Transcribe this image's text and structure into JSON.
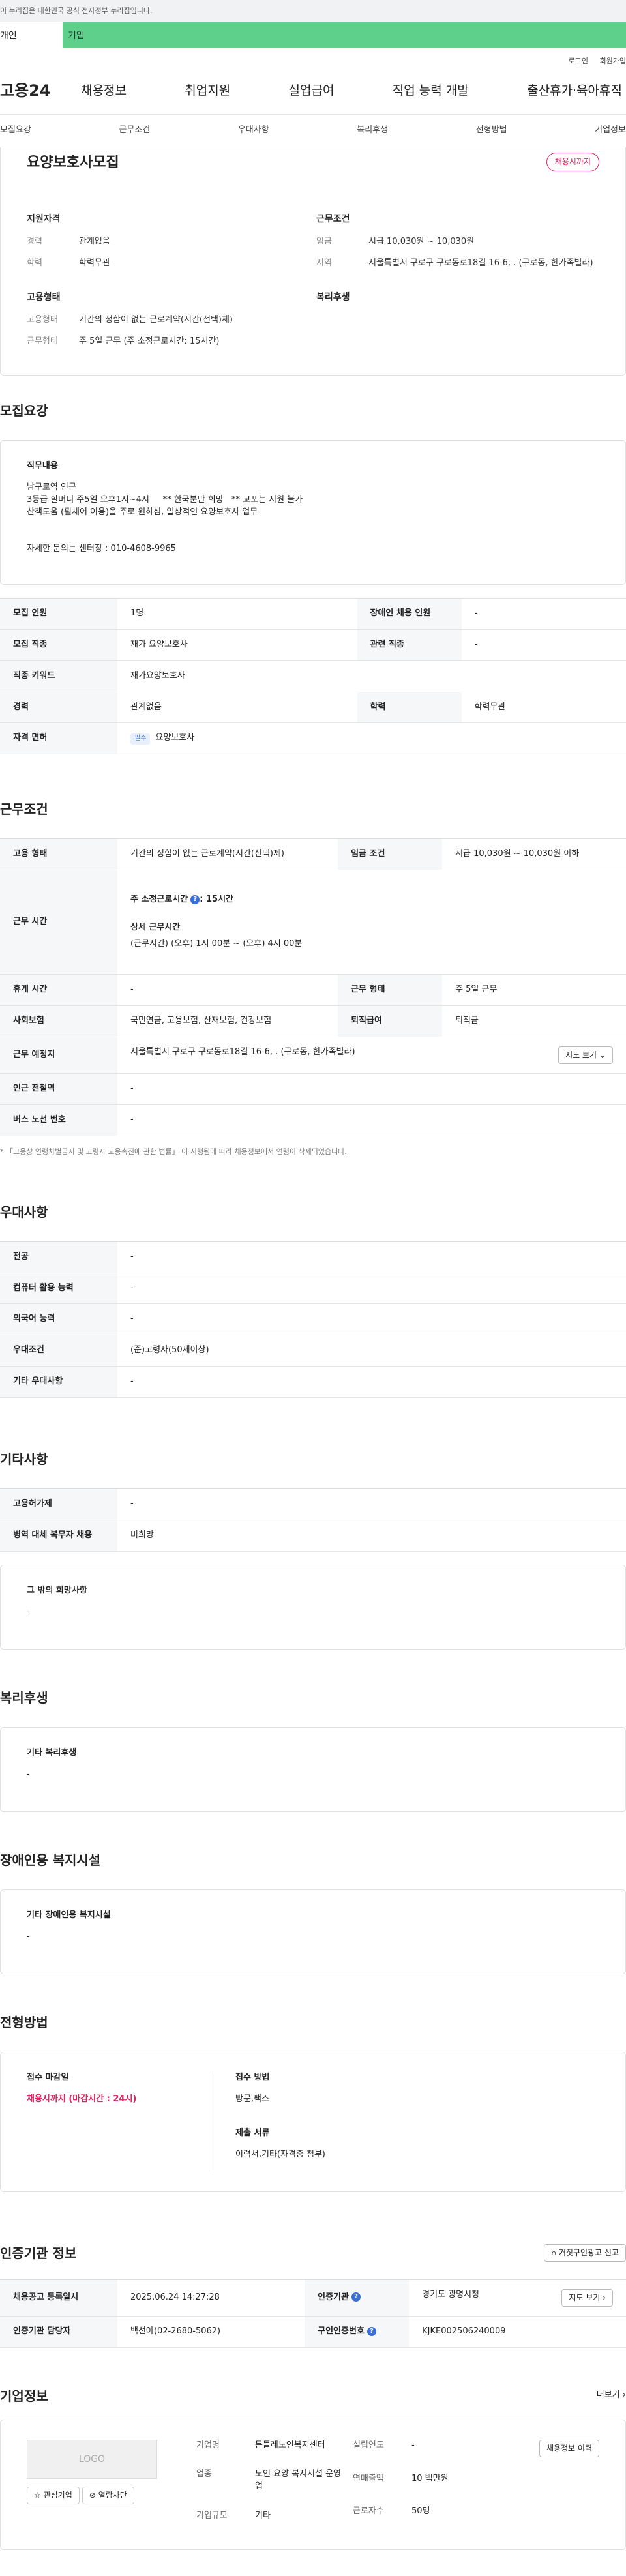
{
  "gov_banner": "이 누리집은 대한민국 공식 전자정부 누리집입니다.",
  "top_tabs": [
    "개인",
    "기업"
  ],
  "util": [
    "로그인",
    "회원가입"
  ],
  "logo": "고용24",
  "gnb": [
    "채용정보",
    "취업지원",
    "실업급여",
    "직업 능력 개발",
    "출산휴가·육아휴직"
  ],
  "subnav": [
    "모집요강",
    "근무조건",
    "우대사항",
    "복리후생",
    "전형방법",
    "기업정보"
  ],
  "summary": {
    "title": "요양보호사모집",
    "badge": "채용시까지",
    "qual_h": "지원자격",
    "career_k": "경력",
    "career_v": "관계없음",
    "edu_k": "학력",
    "edu_v": "학력무관",
    "cond_h": "근무조건",
    "wage_k": "임금",
    "wage_v": "시급 10,030원 ~ 10,030원",
    "area_k": "지역",
    "area_v": "서울특별시 구로구 구로동로18길 16-6, . (구로동, 한가족빌라)",
    "emp_h": "고용형태",
    "emptype_k": "고용형태",
    "emptype_v": "기간의 정함이 없는 근로계약(시간(선택)제)",
    "worktype_k": "근무형태",
    "worktype_v": "주 5일 근무 (주 소정근로시간: 15시간)",
    "welfare_h": "복리후생"
  },
  "recruit": {
    "title": "모집요강",
    "duty_h": "직무내용",
    "duty_1": "남구로역 인근",
    "duty_2": "3등급 할머니 주5일 오후1시~4시     ** 한국분만 희망   ** 교포는 지원 불가",
    "duty_3": "산책도움 (휠체어 이용)을 주로 원하심, 일상적인 요양보호사 업무",
    "contact": "자세한 문의는 센터장 : 010-4608-9965",
    "rows": [
      {
        "k1": "모집 인원",
        "v1": "1명",
        "k2": "장애인 채용 인원",
        "v2": "-"
      },
      {
        "k1": "모집 직종",
        "v1": "재가 요양보호사",
        "k2": "관련 직종",
        "v2": "-"
      },
      {
        "k1": "직종 키워드",
        "v1": "재가요양보호사"
      },
      {
        "k1": "경력",
        "v1": "관계없음",
        "k2": "학력",
        "v2": "학력무관"
      },
      {
        "k1": "자격 면허",
        "tag": "필수",
        "v1": "요양보호사"
      }
    ]
  },
  "conditions": {
    "title": "근무조건",
    "emp_k": "고용 형태",
    "emp_v": "기간의 정함이 없는 근로계약(시간(선택)제)",
    "wage_k": "임금 조건",
    "wage_v": "시급 10,030원 ~ 10,030원 이하",
    "hours_k": "근무 시간",
    "hours_1": "주 소정근로시간",
    "hours_1v": ": 15시간",
    "hours_2": "상세 근무시간",
    "hours_3": "(근무시간) (오후) 1시 00분 ~ (오후) 4시 00분",
    "rest_k": "휴게 시간",
    "rest_v": "-",
    "form_k": "근무 형태",
    "form_v": "주 5일 근무",
    "ins_k": "사회보험",
    "ins_v": "국민연금, 고용보험, 산재보험, 건강보험",
    "sev_k": "퇴직급여",
    "sev_v": "퇴직금",
    "place_k": "근무 예정지",
    "place_v": "서울특별시 구로구 구로동로18길 16-6, . (구로동, 한가족빌라)",
    "map_btn": "지도 보기",
    "station_k": "인근 전철역",
    "station_v": "-",
    "bus_k": "버스 노선 번호",
    "bus_v": "-",
    "note": "* 「고용상 연령차별금지 및 고령자 고용촉진에 관한 법률」 이 시행됨에 따라 채용정보에서 연령이 삭제되었습니다."
  },
  "prefer": {
    "title": "우대사항",
    "rows": [
      {
        "k": "전공",
        "v": "-"
      },
      {
        "k": "컴퓨터 활용 능력",
        "v": "-"
      },
      {
        "k": "외국어 능력",
        "v": "-"
      },
      {
        "k": "우대조건",
        "v": "(준)고령자(50세이상)"
      },
      {
        "k": "기타 우대사항",
        "v": "-"
      }
    ]
  },
  "etc": {
    "title": "기타사항",
    "rows": [
      {
        "k": "고용허가제",
        "v": "-"
      },
      {
        "k": "병역 대체 복무자 채용",
        "v": "비희망"
      }
    ],
    "other_h": "그 밖의 희망사항",
    "other_v": "-"
  },
  "welfare": {
    "title": "복리후생",
    "h": "기타 복리후생",
    "v": "-"
  },
  "disabled": {
    "title": "장애인용 복지시설",
    "h": "기타 장애인용 복지시설",
    "v": "-"
  },
  "selection": {
    "title": "전형방법",
    "deadline_h": "접수 마감일",
    "deadline_v": "채용시까지 (마감시간 : 24시)",
    "method_h": "접수 방법",
    "method_v": "방문,팩스",
    "docs_h": "제출 서류",
    "docs_v": "이력서,기타(자격증 첨부)"
  },
  "agency": {
    "title": "인증기관 정보",
    "report_btn": "거짓구인광고 신고",
    "reg_k": "채용공고 등록일시",
    "reg_v": "2025.06.24 14:27:28",
    "org_k": "인증기관",
    "org_v": "경기도 광명시청",
    "mgr_k": "인증기관 담당자",
    "mgr_v": "백선아(02-2680-5062)",
    "num_k": "구인인증번호",
    "num_v": "KJKE002506240009",
    "map_btn": "지도 보기"
  },
  "company": {
    "title": "기업정보",
    "more": "더보기",
    "logo": "LOGO",
    "fav_btn": "관심기업",
    "block_btn": "열람차단",
    "name_k": "기업명",
    "name_v": "든들레노인복지센터",
    "biz_k": "업종",
    "biz_v": "노인 요양 복지시설 운영업",
    "size_k": "기업규모",
    "size_v": "기타",
    "year_k": "설립연도",
    "year_v": "-",
    "sales_k": "연매출액",
    "sales_v": "10 백만원",
    "emp_k": "근로자수",
    "emp_v": "50명",
    "history_btn": "채용정보 이력"
  }
}
